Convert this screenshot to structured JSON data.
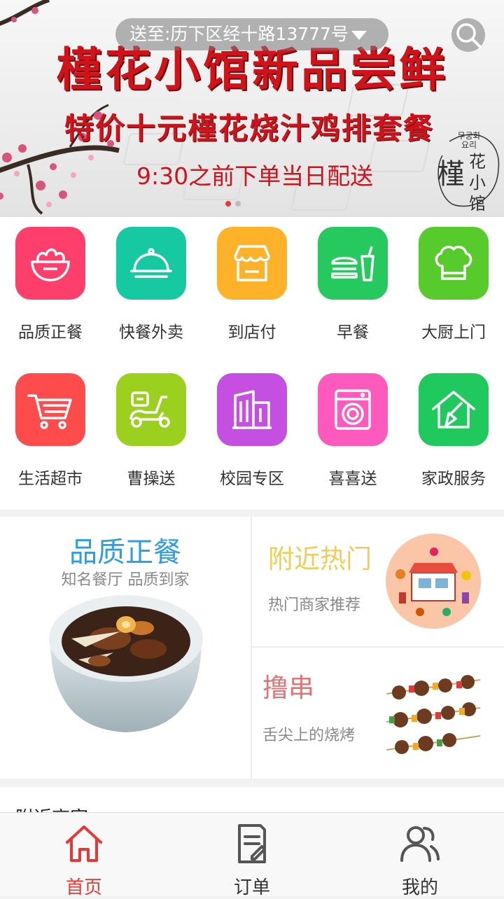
{
  "banner": {
    "address": "送至:历下区经十路13777号",
    "title": "槿花小馆新品尝鲜",
    "subtitle": "特价十元槿花烧汁鸡排套餐",
    "time_note": "9:30之前下单当日配送",
    "logo_korean": "무궁화 요리",
    "logo_big": "槿",
    "logo_small": "花小馆",
    "slide_count": 2,
    "active_slide": 1
  },
  "categories": [
    {
      "label": "品质正餐",
      "icon": "salad-bowl-icon",
      "color": "#fe3f6c"
    },
    {
      "label": "快餐外卖",
      "icon": "cloche-icon",
      "color": "#16c9a3"
    },
    {
      "label": "到店付",
      "icon": "shop-icon",
      "color": "#fdb22a"
    },
    {
      "label": "早餐",
      "icon": "burger-drink-icon",
      "color": "#26c95e"
    },
    {
      "label": "大厨上门",
      "icon": "chef-hat-icon",
      "color": "#58cb2c"
    },
    {
      "label": "生活超市",
      "icon": "cart-icon",
      "color": "#fe4c4c"
    },
    {
      "label": "曹操送",
      "icon": "scooter-icon",
      "color": "#9cd01f"
    },
    {
      "label": "校园专区",
      "icon": "building-icon",
      "color": "#c54fe0"
    },
    {
      "label": "喜喜送",
      "icon": "washer-icon",
      "color": "#fe59bc"
    },
    {
      "label": "家政服务",
      "icon": "house-broom-icon",
      "color": "#20c95d"
    }
  ],
  "promo": {
    "quality": {
      "title": "品质正餐",
      "subtitle": "知名餐厅 品质到家"
    },
    "hot": {
      "title": "附近热门",
      "subtitle": "热门商家推荐"
    },
    "skewer": {
      "title": "撸串",
      "subtitle": "舌尖上的烧烤"
    }
  },
  "nearby": {
    "title": "附近商家"
  },
  "tabs": [
    {
      "label": "首页",
      "icon": "home-icon",
      "active": true
    },
    {
      "label": "订单",
      "icon": "order-icon",
      "active": false
    },
    {
      "label": "我的",
      "icon": "user-icon",
      "active": false
    }
  ],
  "colors": {
    "accent": "#e53935",
    "tab_inactive": "#555555"
  }
}
